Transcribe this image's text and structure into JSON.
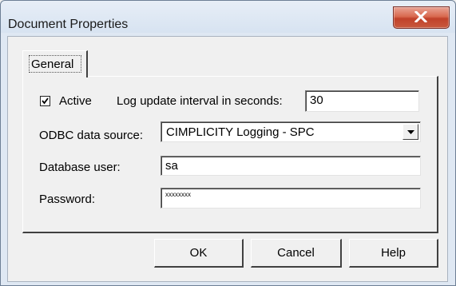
{
  "window": {
    "title": "Document Properties",
    "close_icon": "close-x-icon"
  },
  "tabs": [
    {
      "label": "General",
      "selected": true
    }
  ],
  "general": {
    "active_label": "Active",
    "active_checked": true,
    "log_interval_label": "Log update interval in seconds:",
    "log_interval_value": "30",
    "odbc_label": "ODBC data source:",
    "odbc_value": "CIMPLICITY Logging - SPC",
    "db_user_label": "Database user:",
    "db_user_value": "sa",
    "password_label": "Password:",
    "password_value": "xxxxxxxx"
  },
  "buttons": {
    "ok": "OK",
    "cancel": "Cancel",
    "help": "Help"
  }
}
